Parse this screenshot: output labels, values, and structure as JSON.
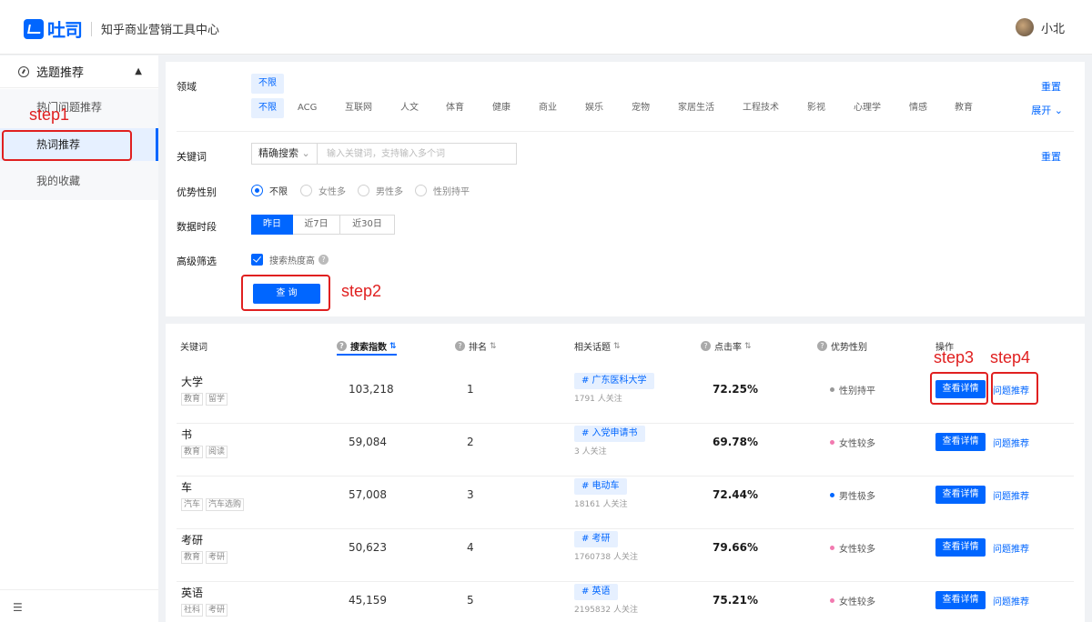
{
  "header": {
    "logo_text": "吐司",
    "subtitle": "知乎商业营销工具中心",
    "user_name": "小北"
  },
  "sidebar": {
    "group_label": "选题推荐",
    "items": [
      {
        "label": "热门问题推荐"
      },
      {
        "label": "热词推荐"
      },
      {
        "label": "我的收藏"
      }
    ]
  },
  "annotations": {
    "step1": "step1",
    "step2": "step2",
    "step3": "step3",
    "step4": "step4"
  },
  "filter": {
    "domain_label": "领域",
    "domain_selected": "不限",
    "domain_tags": [
      "不限",
      "ACG",
      "互联网",
      "人文",
      "体育",
      "健康",
      "商业",
      "娱乐",
      "宠物",
      "家居生活",
      "工程技术",
      "影视",
      "心理学",
      "情感",
      "教育"
    ],
    "reset_label": "重置",
    "expand_label": "展开",
    "keyword_label": "关键词",
    "keyword_mode": "精确搜索",
    "keyword_placeholder": "输入关键词，支持输入多个词",
    "gender_label": "优势性别",
    "gender_options": [
      "不限",
      "女性多",
      "男性多",
      "性别持平"
    ],
    "period_label": "数据时段",
    "period_options": [
      "昨日",
      "近7日",
      "近30日"
    ],
    "advanced_label": "高级筛选",
    "advanced_check": "搜索热度高",
    "query_label": "查 询"
  },
  "table": {
    "headers": {
      "keyword": "关键词",
      "search_index": "搜索指数",
      "rank": "排名",
      "topic": "相关话题",
      "ctr": "点击率",
      "gender": "优势性别",
      "action": "操作"
    },
    "detail_label": "查看详情",
    "question_label": "问题推荐",
    "rows": [
      {
        "keyword": "大学",
        "tags": [
          "教育",
          "留学"
        ],
        "index": "103,218",
        "rank": "1",
        "topic": "# 广东医科大学",
        "followers": "1791 人关注",
        "ctr": "72.25%",
        "gender": "性别持平",
        "gender_color": "#999999"
      },
      {
        "keyword": "书",
        "tags": [
          "教育",
          "阅读"
        ],
        "index": "59,084",
        "rank": "2",
        "topic": "# 入党申请书",
        "followers": "3 人关注",
        "ctr": "69.78%",
        "gender": "女性较多",
        "gender_color": "#f27ab0"
      },
      {
        "keyword": "车",
        "tags": [
          "汽车",
          "汽车选购"
        ],
        "index": "57,008",
        "rank": "3",
        "topic": "# 电动车",
        "followers": "18161 人关注",
        "ctr": "72.44%",
        "gender": "男性极多",
        "gender_color": "#0066ff"
      },
      {
        "keyword": "考研",
        "tags": [
          "教育",
          "考研"
        ],
        "index": "50,623",
        "rank": "4",
        "topic": "# 考研",
        "followers": "1760738 人关注",
        "ctr": "79.66%",
        "gender": "女性较多",
        "gender_color": "#f27ab0"
      },
      {
        "keyword": "英语",
        "tags": [
          "社科",
          "考研"
        ],
        "index": "45,159",
        "rank": "5",
        "topic": "# 英语",
        "followers": "2195832 人关注",
        "ctr": "75.21%",
        "gender": "女性较多",
        "gender_color": "#f27ab0"
      }
    ]
  }
}
